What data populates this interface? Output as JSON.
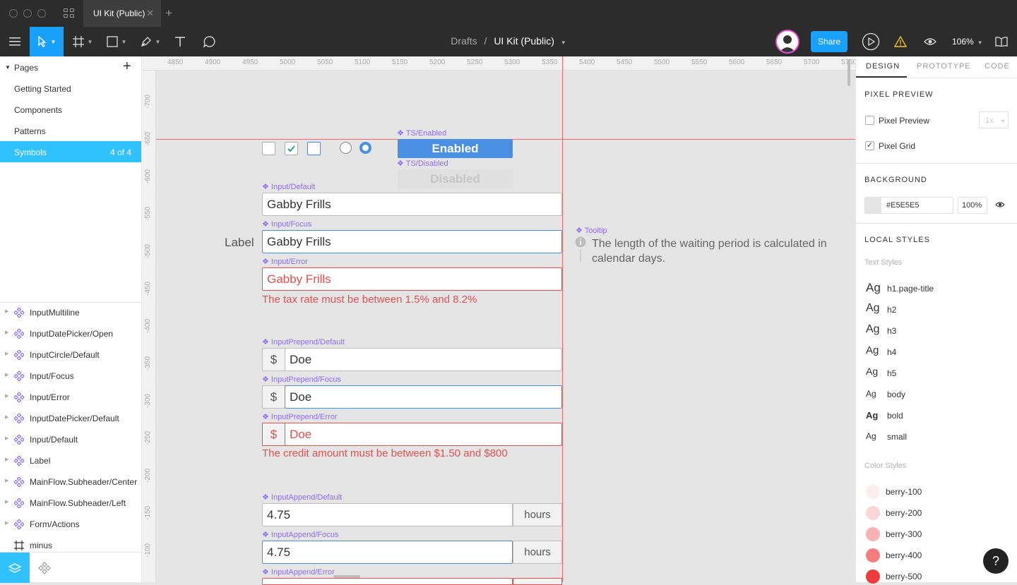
{
  "window": {
    "tab_title": "UI Kit (Public)"
  },
  "toolbar": {
    "breadcrumb_parent": "Drafts",
    "breadcrumb_sep": "/",
    "file_name": "UI Kit (Public)",
    "share_label": "Share",
    "zoom": "106%"
  },
  "pages": {
    "header": "Pages",
    "items": [
      {
        "label": "Getting Started"
      },
      {
        "label": "Components"
      },
      {
        "label": "Patterns"
      },
      {
        "label": "Symbols",
        "count": "4 of 4"
      }
    ]
  },
  "layers": [
    {
      "label": "InputMultiline",
      "icon": "component-icon"
    },
    {
      "label": "InputDatePicker/Open",
      "icon": "component-icon"
    },
    {
      "label": "InputCircle/Default",
      "icon": "component-icon"
    },
    {
      "label": "Input/Focus",
      "icon": "component-icon"
    },
    {
      "label": "Input/Error",
      "icon": "component-icon"
    },
    {
      "label": "InputDatePicker/Default",
      "icon": "component-icon"
    },
    {
      "label": "Input/Default",
      "icon": "component-icon"
    },
    {
      "label": "Label",
      "icon": "component-icon"
    },
    {
      "label": "MainFlow.Subheader/Center",
      "icon": "component-icon"
    },
    {
      "label": "MainFlow.Subheader/Left",
      "icon": "component-icon"
    },
    {
      "label": "Form/Actions",
      "icon": "component-icon"
    },
    {
      "label": "minus",
      "icon": "frame-icon"
    }
  ],
  "ruler": {
    "h": [
      "4850",
      "4900",
      "4950",
      "5000",
      "5050",
      "5100",
      "5150",
      "5200",
      "5250",
      "5300",
      "5350",
      "5400",
      "5450",
      "5500",
      "5550",
      "5600",
      "5650",
      "5700",
      "5750"
    ],
    "v": [
      "-700",
      "-650",
      "-600",
      "-550",
      "-500",
      "-450",
      "-400",
      "-350",
      "-300",
      "-250",
      "-200",
      "-150",
      "-100"
    ]
  },
  "canvas": {
    "ts_enabled_tag": "TS/Enabled",
    "ts_enabled_label": "Enabled",
    "ts_disabled_tag": "TS/Disabled",
    "ts_disabled_label": "Disabled",
    "side_label": "Label",
    "input_default_tag": "Input/Default",
    "input_default_value": "Gabby Frills",
    "input_focus_tag": "Input/Focus",
    "input_focus_value": "Gabby Frills",
    "input_error_tag": "Input/Error",
    "input_error_value": "Gabby Frills",
    "input_error_msg": "The tax rate must be between 1.5% and 8.2%",
    "tooltip_tag": "Tooltip",
    "tooltip_text": "The length of the waiting period is calculated in calendar days.",
    "prepend_default_tag": "InputPrepend/Default",
    "prepend_focus_tag": "InputPrepend/Focus",
    "prepend_error_tag": "InputPrepend/Error",
    "prepend_symbol": "$",
    "prepend_value": "Doe",
    "prepend_error_msg": "The credit amount must be between $1.50 and $800",
    "append_default_tag": "InputAppend/Default",
    "append_focus_tag": "InputAppend/Focus",
    "append_error_tag": "InputAppend/Error",
    "append_value": "4.75",
    "append_unit": "hours"
  },
  "right": {
    "tabs": [
      "DESIGN",
      "PROTOTYPE",
      "CODE"
    ],
    "pixel_preview_header": "PIXEL PREVIEW",
    "pixel_preview_label": "Pixel Preview",
    "pixel_preview_checked": false,
    "pixel_preview_scale": "1x",
    "pixel_grid_label": "Pixel Grid",
    "pixel_grid_checked": true,
    "background_header": "BACKGROUND",
    "background_hex": "#E5E5E5",
    "background_opacity": "100%",
    "local_styles_header": "LOCAL STYLES",
    "text_styles_header": "Text Styles",
    "text_styles": [
      {
        "sample": "Ag",
        "name": "h1.page-title"
      },
      {
        "sample": "Ag",
        "name": "h2"
      },
      {
        "sample": "Ag",
        "name": "h3"
      },
      {
        "sample": "Ag",
        "name": "h4"
      },
      {
        "sample": "Ag",
        "name": "h5"
      },
      {
        "sample": "Ag",
        "name": "body"
      },
      {
        "sample": "Ag",
        "name": "bold"
      },
      {
        "sample": "Ag",
        "name": "small"
      }
    ],
    "color_styles_header": "Color Styles",
    "color_styles": [
      {
        "name": "berry-100",
        "color": "#fdeeee"
      },
      {
        "name": "berry-200",
        "color": "#fcd6d6"
      },
      {
        "name": "berry-300",
        "color": "#f9b2b2"
      },
      {
        "name": "berry-400",
        "color": "#f47e7e"
      },
      {
        "name": "berry-500",
        "color": "#ee3b3b"
      }
    ]
  },
  "help_label": "?"
}
